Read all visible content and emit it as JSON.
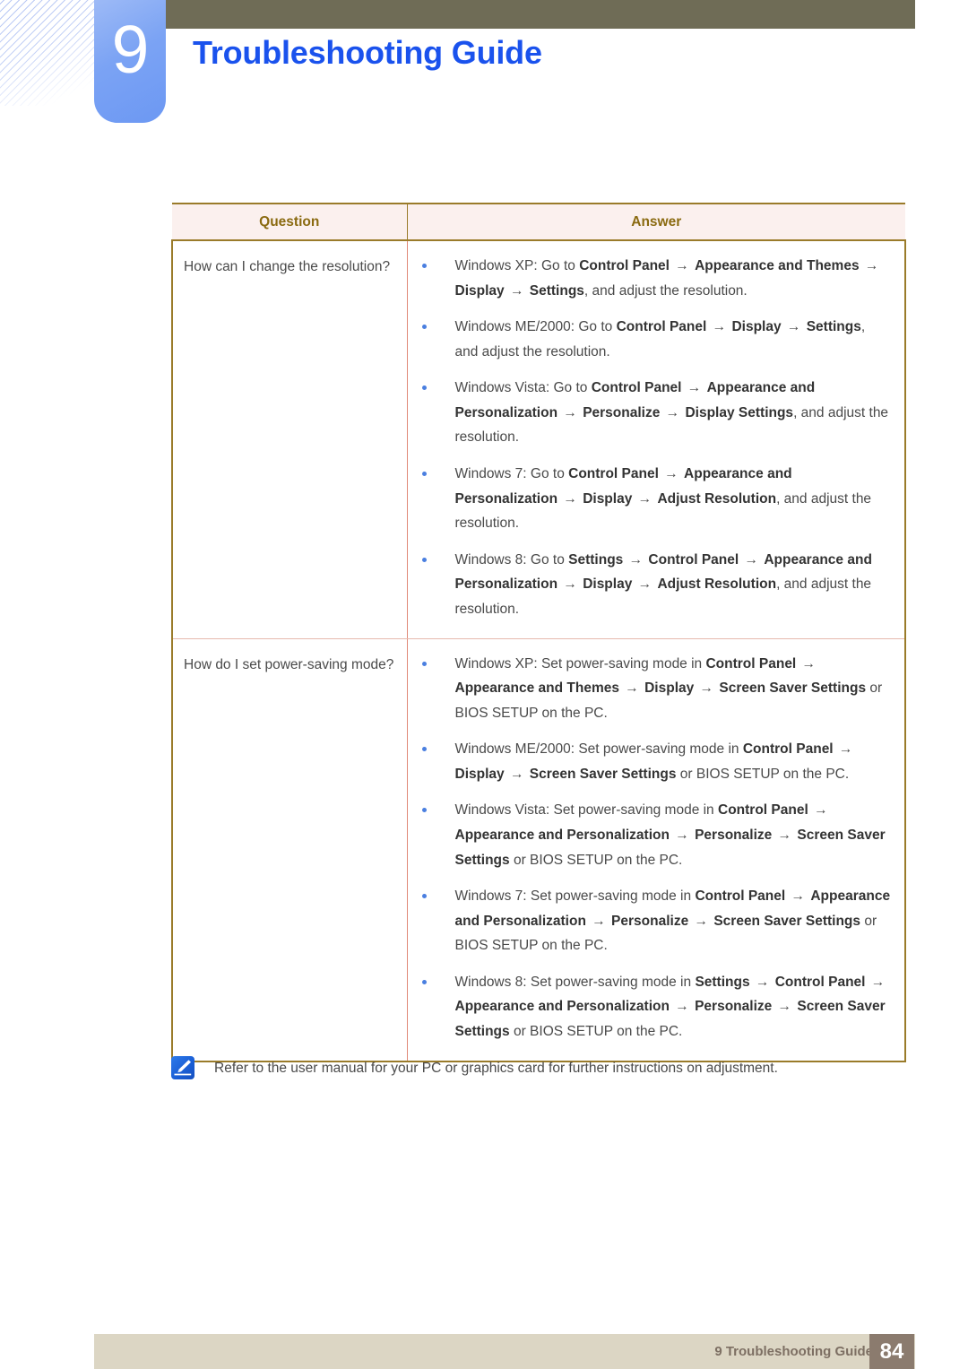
{
  "header": {
    "chapter_number": "9",
    "chapter_title": "Troubleshooting Guide",
    "title_color": "#1a52ed",
    "bar_color": "#6f6c56",
    "badge_color": "#7ba3f4"
  },
  "table": {
    "columns": [
      "Question",
      "Answer"
    ],
    "header_bg": "#fbf0ee",
    "header_text_color": "#8a6a10",
    "border_color": "#9a7b2a",
    "inner_divider_color": "#e08a78",
    "bullet_color": "#4a7fe0",
    "rows": [
      {
        "question": "How can I change the resolution?",
        "answers": [
          [
            {
              "t": "Windows XP: Go to ",
              "b": false
            },
            {
              "t": "Control Panel",
              "b": true
            },
            {
              "t": " → ",
              "b": true
            },
            {
              "t": "Appearance and Themes",
              "b": true
            },
            {
              "t": " → ",
              "b": true
            },
            {
              "t": "Display",
              "b": true
            },
            {
              "t": " → ",
              "b": true
            },
            {
              "t": "Settings",
              "b": true
            },
            {
              "t": ", and adjust the resolution.",
              "b": false
            }
          ],
          [
            {
              "t": "Windows ME/2000: Go to ",
              "b": false
            },
            {
              "t": "Control Panel",
              "b": true
            },
            {
              "t": " → ",
              "b": true
            },
            {
              "t": "Display",
              "b": true
            },
            {
              "t": " → ",
              "b": true
            },
            {
              "t": "Settings",
              "b": true
            },
            {
              "t": ", and adjust the resolution.",
              "b": false
            }
          ],
          [
            {
              "t": "Windows Vista: Go to ",
              "b": false
            },
            {
              "t": "Control Panel",
              "b": true
            },
            {
              "t": " → ",
              "b": true
            },
            {
              "t": "Appearance and Personalization",
              "b": true
            },
            {
              "t": " → ",
              "b": true
            },
            {
              "t": "Personalize",
              "b": true
            },
            {
              "t": " → ",
              "b": true
            },
            {
              "t": "Display Settings",
              "b": true
            },
            {
              "t": ", and adjust the resolution.",
              "b": false
            }
          ],
          [
            {
              "t": "Windows 7: Go to ",
              "b": false
            },
            {
              "t": "Control Panel",
              "b": true
            },
            {
              "t": " → ",
              "b": true
            },
            {
              "t": "Appearance and Personalization",
              "b": true
            },
            {
              "t": " → ",
              "b": true
            },
            {
              "t": "Display",
              "b": true
            },
            {
              "t": " → ",
              "b": true
            },
            {
              "t": "Adjust Resolution",
              "b": true
            },
            {
              "t": ", and adjust the resolution.",
              "b": false
            }
          ],
          [
            {
              "t": "Windows 8: Go to ",
              "b": false
            },
            {
              "t": "Settings",
              "b": true
            },
            {
              "t": " → ",
              "b": true
            },
            {
              "t": "Control Panel",
              "b": true
            },
            {
              "t": " → ",
              "b": true
            },
            {
              "t": "Appearance and Personalization",
              "b": true
            },
            {
              "t": " → ",
              "b": true
            },
            {
              "t": "Display",
              "b": true
            },
            {
              "t": " → ",
              "b": true
            },
            {
              "t": "Adjust Resolution",
              "b": true
            },
            {
              "t": ", and adjust the resolution.",
              "b": false
            }
          ]
        ]
      },
      {
        "question": "How do I set power-saving mode?",
        "answers": [
          [
            {
              "t": "Windows XP: Set power-saving mode in ",
              "b": false
            },
            {
              "t": "Control Panel",
              "b": true
            },
            {
              "t": " → ",
              "b": true
            },
            {
              "t": "Appearance and Themes",
              "b": true
            },
            {
              "t": " → ",
              "b": true
            },
            {
              "t": "Display",
              "b": true
            },
            {
              "t": " → ",
              "b": true
            },
            {
              "t": "Screen Saver Settings",
              "b": true
            },
            {
              "t": " or BIOS SETUP on the PC.",
              "b": false
            }
          ],
          [
            {
              "t": "Windows ME/2000: Set power-saving mode in ",
              "b": false
            },
            {
              "t": "Control Panel",
              "b": true
            },
            {
              "t": " → ",
              "b": true
            },
            {
              "t": "Display",
              "b": true
            },
            {
              "t": " → ",
              "b": true
            },
            {
              "t": "Screen Saver Settings",
              "b": true
            },
            {
              "t": " or BIOS SETUP on the PC.",
              "b": false
            }
          ],
          [
            {
              "t": "Windows Vista: Set power-saving mode in ",
              "b": false
            },
            {
              "t": "Control Panel",
              "b": true
            },
            {
              "t": " → ",
              "b": true
            },
            {
              "t": "Appearance and Personalization",
              "b": true
            },
            {
              "t": " → ",
              "b": true
            },
            {
              "t": "Personalize",
              "b": true
            },
            {
              "t": " → ",
              "b": true
            },
            {
              "t": "Screen Saver Settings",
              "b": true
            },
            {
              "t": " or BIOS SETUP on the PC.",
              "b": false
            }
          ],
          [
            {
              "t": "Windows 7: Set power-saving mode in ",
              "b": false
            },
            {
              "t": "Control Panel",
              "b": true
            },
            {
              "t": " → ",
              "b": true
            },
            {
              "t": "Appearance and Personalization",
              "b": true
            },
            {
              "t": " → ",
              "b": true
            },
            {
              "t": "Personalize",
              "b": true
            },
            {
              "t": " → ",
              "b": true
            },
            {
              "t": "Screen Saver Settings",
              "b": true
            },
            {
              "t": " or BIOS SETUP on the PC.",
              "b": false
            }
          ],
          [
            {
              "t": "Windows 8: Set power-saving mode in ",
              "b": false
            },
            {
              "t": "Settings",
              "b": true
            },
            {
              "t": " → ",
              "b": true
            },
            {
              "t": "Control Panel",
              "b": true
            },
            {
              "t": " → ",
              "b": true
            },
            {
              "t": "Appearance and Personalization",
              "b": true
            },
            {
              "t": " → ",
              "b": true
            },
            {
              "t": "Personalize",
              "b": true
            },
            {
              "t": " → ",
              "b": true
            },
            {
              "t": "Screen Saver Settings",
              "b": true
            },
            {
              "t": " or BIOS SETUP on the PC.",
              "b": false
            }
          ]
        ]
      }
    ]
  },
  "note": {
    "icon": "note-pen-icon",
    "text": "Refer to the user manual for your PC or graphics card for further instructions on adjustment."
  },
  "footer": {
    "label": "9 Troubleshooting Guide",
    "page_number": "84",
    "bar_color": "#dcd6c4",
    "page_box_color": "#8b7b6e"
  }
}
